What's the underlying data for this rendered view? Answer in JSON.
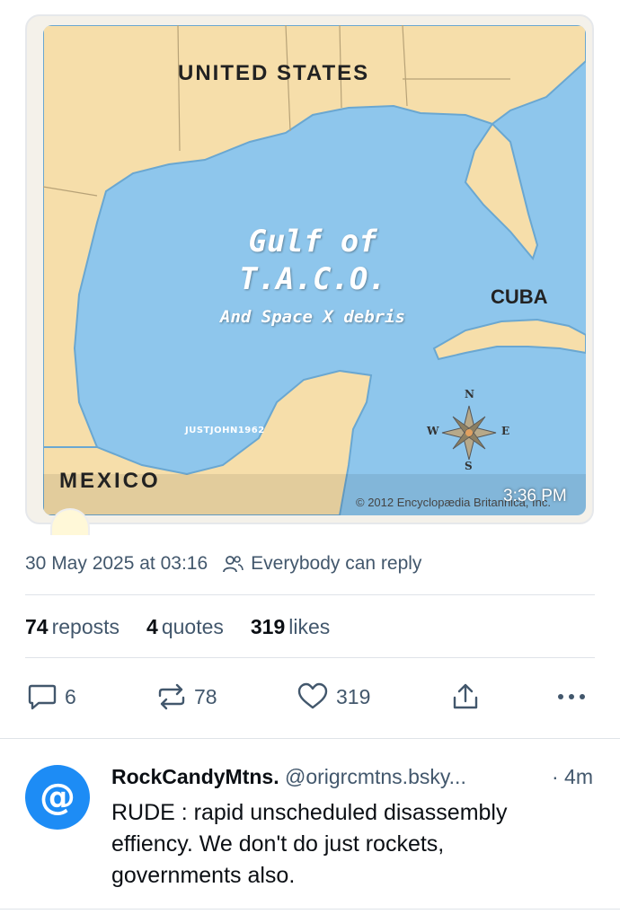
{
  "post_image": {
    "map_labels": {
      "united_states": "UNITED STATES",
      "mexico": "MEXICO",
      "cuba": "CUBA"
    },
    "gulf_title_line1": "Gulf of",
    "gulf_title_line2": "T.A.C.O.",
    "gulf_subtitle": "And Space X debris",
    "watermark": "JUSTJOHN1962",
    "copyright": "© 2012 Encyclopædia Britannica, Inc.",
    "overlay_time": "3:36 PM",
    "compass": {
      "n": "N",
      "s": "S",
      "e": "E",
      "w": "W"
    },
    "colors": {
      "water": "#8ec6ec",
      "land": "#f6deaa"
    }
  },
  "meta": {
    "date": "30 May 2025 at 03:16",
    "reply_permission": "Everybody can reply"
  },
  "stats": {
    "reposts_count": "74",
    "reposts_label": "reposts",
    "quotes_count": "4",
    "quotes_label": "quotes",
    "likes_count": "319",
    "likes_label": "likes"
  },
  "actions": {
    "reply_count": "6",
    "repost_count": "78",
    "like_count": "319"
  },
  "reply": {
    "avatar_glyph": "@",
    "display_name": "RockCandyMtns.",
    "handle": "@origrcmtns.bsky...",
    "time": "· 4m",
    "text": "RUDE : rapid unscheduled disassembly effiency. We don't do just rockets, governments also."
  },
  "colors": {
    "accent": "#1d8cf5",
    "muted_text": "#42576c",
    "divider": "#dfe3e8"
  }
}
